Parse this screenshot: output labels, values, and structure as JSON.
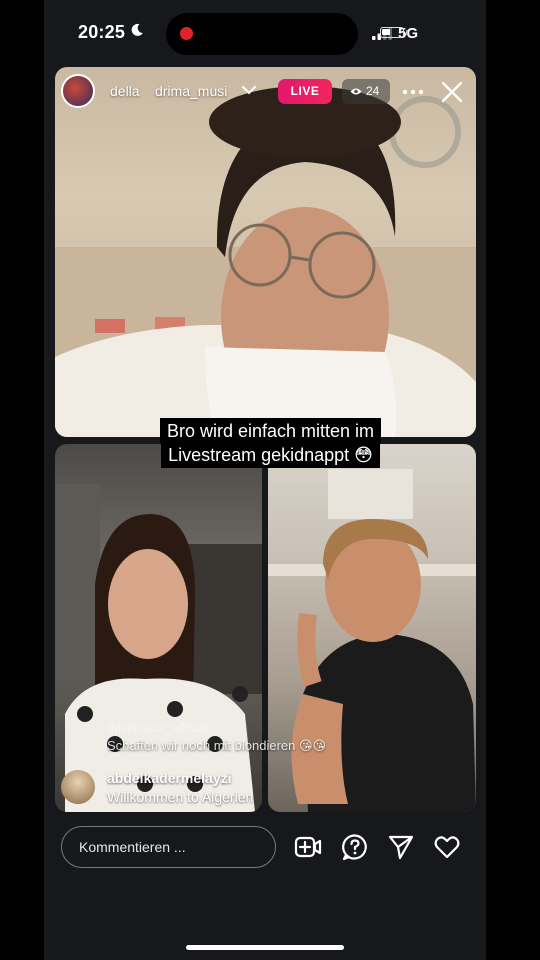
{
  "status_bar": {
    "time": "20:25",
    "network": "5G",
    "battery_percent": 40
  },
  "header": {
    "host_username": "della",
    "guest_username": "drima_musi",
    "live_label": "LIVE",
    "viewer_count": "24"
  },
  "caption": {
    "line1": "Bro wird einfach mitten im",
    "line2": "Livestream gekidnappt 😳"
  },
  "comments": [
    {
      "username": "thisiscoco_official",
      "text": "Schaffen wir noch mit blondieren 😘😘"
    },
    {
      "username": "abdelkadermelayzi",
      "text": "Willkommen to Algerien"
    }
  ],
  "bottom_bar": {
    "comment_placeholder": "Kommentieren ..."
  },
  "icons": [
    "moon-icon",
    "signal-icon",
    "battery-icon",
    "chevron-down-icon",
    "eye-icon",
    "more-icon",
    "close-icon",
    "add-guest-icon",
    "question-icon",
    "send-icon",
    "heart-icon"
  ],
  "colors": {
    "live_badge": "#e3176d",
    "background": "#17181b"
  }
}
